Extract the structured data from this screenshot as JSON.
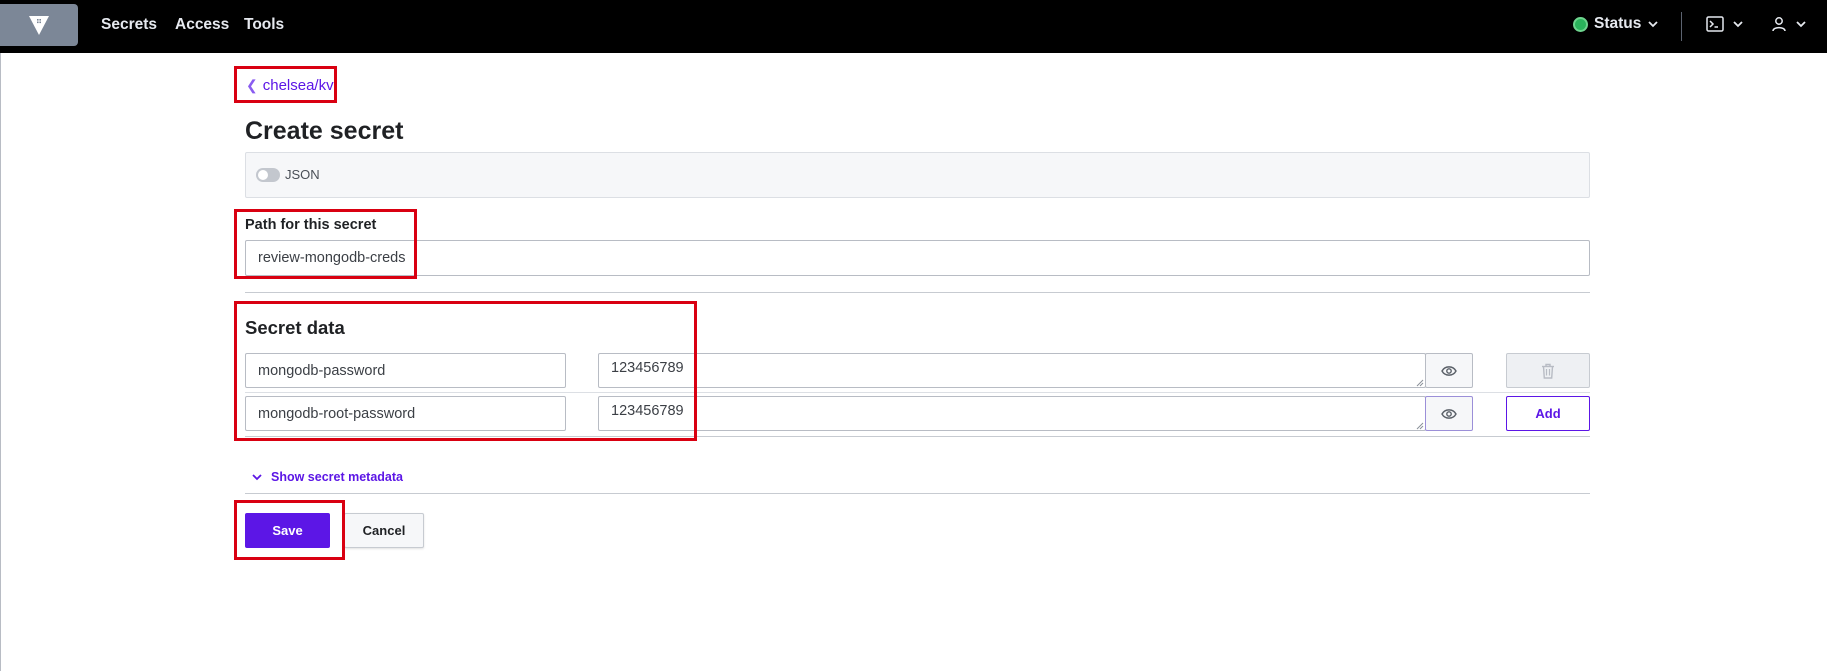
{
  "topbar": {
    "nav": [
      "Secrets",
      "Access",
      "Tools"
    ],
    "status_label": "Status",
    "status_color": "#2ab35b",
    "icons": [
      "vault-logo-icon",
      "console-icon",
      "user-icon",
      "chevron-down-icon"
    ]
  },
  "breadcrumb": {
    "label": "chelsea/kv"
  },
  "page": {
    "title": "Create secret"
  },
  "json_toggle": {
    "label": "JSON",
    "enabled": false
  },
  "path": {
    "label": "Path for this secret",
    "value": "review-mongodb-creds"
  },
  "secret_data": {
    "title": "Secret data",
    "rows": [
      {
        "key": "mongodb-password",
        "value": "123456789"
      },
      {
        "key": "mongodb-root-password",
        "value": "123456789"
      }
    ],
    "add_label": "Add"
  },
  "metadata": {
    "label": "Show secret metadata"
  },
  "actions": {
    "save_label": "Save",
    "cancel_label": "Cancel"
  },
  "colors": {
    "accent": "#5c16e6",
    "annotation": "#d90011",
    "topbar": "#000000"
  }
}
